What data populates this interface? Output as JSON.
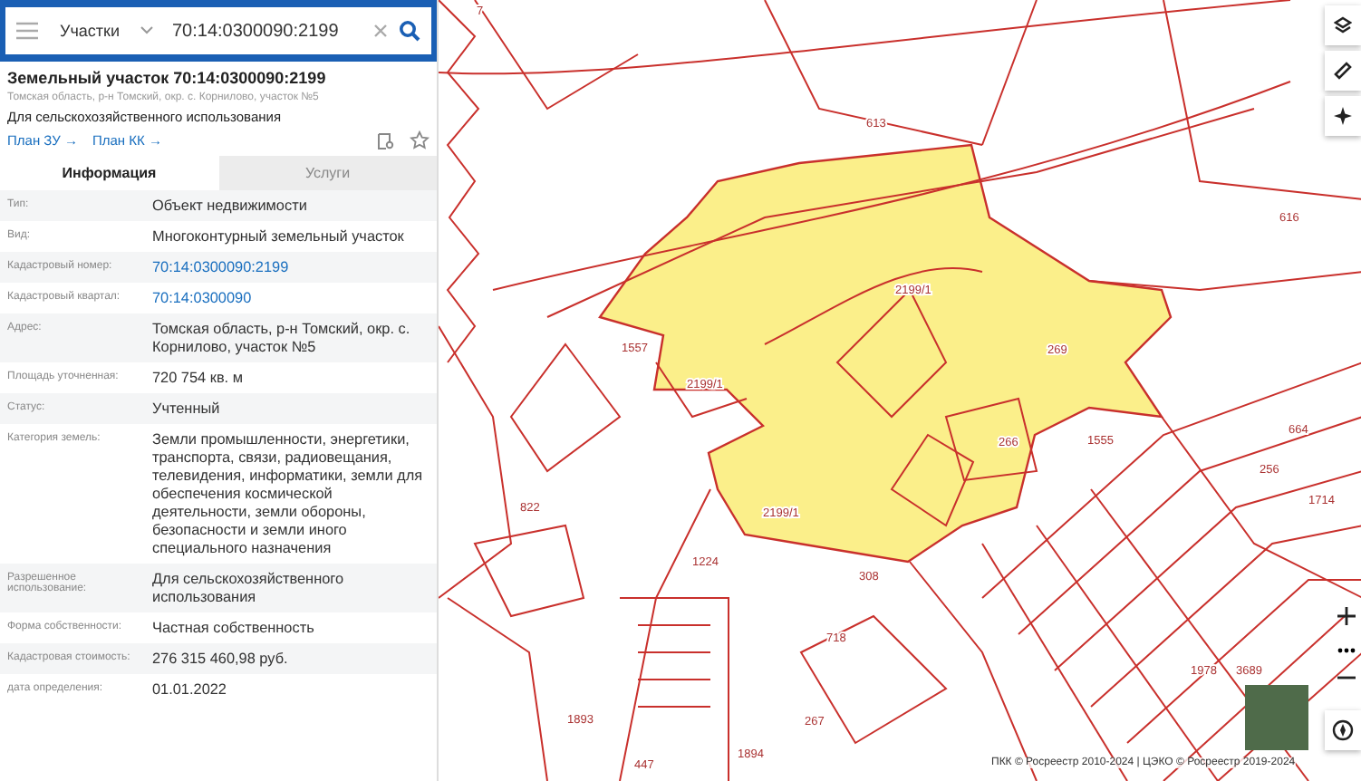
{
  "search": {
    "category": "Участки",
    "value": "70:14:0300090:2199"
  },
  "parcel": {
    "title": "Земельный участок 70:14:0300090:2199",
    "address": "Томская область, р-н Томский, окр. с. Корнилово, участок №5",
    "purpose": "Для сельскохозяйственного использования",
    "links": [
      "План ЗУ →",
      "План КК →"
    ]
  },
  "tabs": [
    {
      "label": "Информация",
      "selected": true
    },
    {
      "label": "Услуги",
      "selected": false
    }
  ],
  "properties": [
    {
      "label": "Тип:",
      "value": "Объект недвижимости",
      "kind": "text"
    },
    {
      "label": "Вид:",
      "value": "Многоконтурный земельный участок",
      "kind": "text"
    },
    {
      "label": "Кадастровый номер:",
      "value": "70:14:0300090:2199",
      "kind": "link"
    },
    {
      "label": "Кадастровый квартал:",
      "value": "70:14:0300090",
      "kind": "link"
    },
    {
      "label": "Адрес:",
      "value": "Томская область, р-н Томский, окр. с. Корнилово, участок №5",
      "kind": "text"
    },
    {
      "label": "Площадь уточненная:",
      "value": "720 754 кв. м",
      "kind": "text"
    },
    {
      "label": "Статус:",
      "value": "Учтенный",
      "kind": "text"
    },
    {
      "label": "Категория земель:",
      "value": "Земли промышленности, энергетики, транспорта, связи, радиовещания, телевидения, информатики, земли для обеспечения космической деятельности, земли обороны, безопасности и земли иного специального назначения",
      "kind": "text"
    },
    {
      "label": "Разрешенное использование:",
      "value": "Для сельскохозяйственного использования",
      "kind": "text"
    },
    {
      "label": "Форма собственности:",
      "value": "Частная собственность",
      "kind": "text"
    },
    {
      "label": "Кадастровая стоимость:",
      "value": "276 315 460,98 руб.",
      "kind": "text"
    },
    {
      "label": "дата определения:",
      "value": "01.01.2022",
      "kind": "text"
    }
  ],
  "map": {
    "labels": [
      "7",
      "613",
      "616",
      "2199/1",
      "1557",
      "2199/1",
      "269",
      "266",
      "1555",
      "664",
      "256",
      "822",
      "2199/1",
      "1224",
      "1714",
      "718",
      "308",
      "1978",
      "3689",
      "1893",
      "267",
      "1894",
      "447"
    ],
    "attribution": "ПКК © Росреестр 2010-2024 | ЦЭКО © Росреестр 2019-2024"
  }
}
